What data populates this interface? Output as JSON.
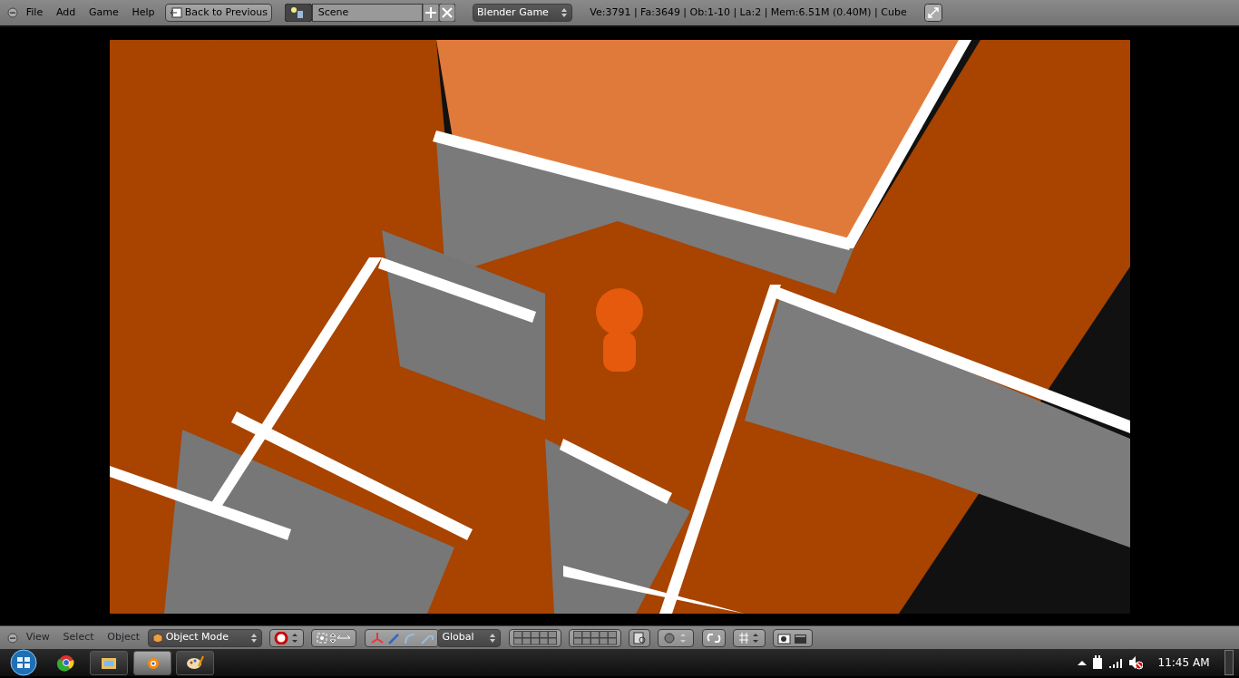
{
  "top_header": {
    "menus": [
      "File",
      "Add",
      "Game",
      "Help"
    ],
    "back_button": "Back to Previous",
    "scene": "Scene",
    "engine": "Blender Game",
    "stats": "Ve:3791 | Fa:3649 | Ob:1-10 | La:2 | Mem:6.51M (0.40M) | Cube"
  },
  "bottom_header": {
    "menus": [
      "View",
      "Select",
      "Object"
    ],
    "mode": "Object Mode",
    "orientation": "Global"
  },
  "taskbar": {
    "clock": "11:45 AM"
  }
}
